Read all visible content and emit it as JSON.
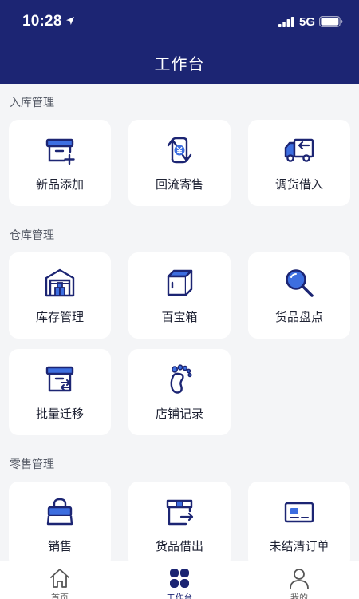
{
  "status_bar": {
    "time": "10:28",
    "network": "5G"
  },
  "header": {
    "title": "工作台"
  },
  "sections": [
    {
      "title": "入库管理",
      "items": [
        {
          "label": "新品添加",
          "icon": "box-add-icon"
        },
        {
          "label": "回流寄售",
          "icon": "yen-cycle-icon"
        },
        {
          "label": "调货借入",
          "icon": "truck-icon"
        }
      ]
    },
    {
      "title": "仓库管理",
      "items": [
        {
          "label": "库存管理",
          "icon": "warehouse-icon"
        },
        {
          "label": "百宝箱",
          "icon": "treasure-box-icon"
        },
        {
          "label": "货品盘点",
          "icon": "magnifier-icon"
        },
        {
          "label": "批量迁移",
          "icon": "box-transfer-icon"
        },
        {
          "label": "店铺记录",
          "icon": "footprint-icon"
        }
      ]
    },
    {
      "title": "零售管理",
      "items": [
        {
          "label": "销售",
          "icon": "shopping-bag-icon"
        },
        {
          "label": "货品借出",
          "icon": "box-lend-icon"
        },
        {
          "label": "未结清订单",
          "icon": "card-icon"
        }
      ]
    }
  ],
  "tabbar": {
    "items": [
      {
        "label": "首页",
        "icon": "home-icon"
      },
      {
        "label": "工作台",
        "icon": "grid-icon"
      },
      {
        "label": "我的",
        "icon": "person-icon"
      }
    ]
  },
  "colors": {
    "primary": "#1c2573",
    "accent": "#3d6ee0",
    "background": "#f4f5f7"
  }
}
